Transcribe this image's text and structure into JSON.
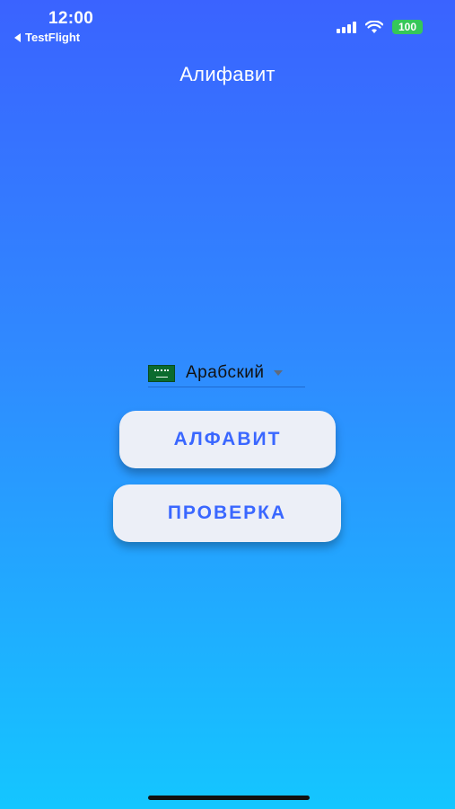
{
  "status_bar": {
    "time": "12:00",
    "back_app": "TestFlight",
    "battery": "100",
    "icons": [
      "signal-icon",
      "wifi-icon",
      "battery-icon",
      "back-arrow-icon"
    ]
  },
  "header": {
    "title": "Алифавит"
  },
  "language_selector": {
    "selected": "Арабский",
    "flag_icon": "saudi-arabia-flag-icon"
  },
  "buttons": {
    "alphabet": "АЛФАВИТ",
    "check": "ПРОВЕРКА"
  },
  "colors": {
    "gradient_top": "#3a63ff",
    "gradient_bottom": "#14c6ff",
    "button_bg": "#eceff7",
    "button_text": "#3a67ff",
    "battery_green": "#35c759"
  }
}
